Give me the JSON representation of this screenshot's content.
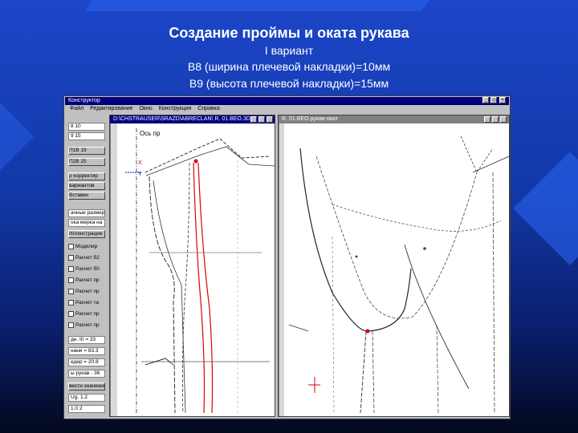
{
  "slide": {
    "title": "Создание проймы и оката рукава",
    "variant": "I вариант",
    "line_b8": "В8 (ширина плечевой накладки)=10мм",
    "line_b9": "В9  (высота плечевой накладки)=15мм"
  },
  "app": {
    "title": "Конструктор",
    "menu": [
      "Файл",
      "Редактирование",
      "Окно",
      "Конструкция",
      "Справка"
    ],
    "window_buttons": [
      "_",
      "□",
      "×"
    ],
    "panel": {
      "fields": [
        {
          "label": "8",
          "value": "10"
        },
        {
          "label": "9",
          "value": "15"
        }
      ],
      "buttons": [
        "П1В 19",
        "П2В 25",
        "р корректир",
        "вариантов",
        "Вставки"
      ],
      "info_rows": [
        "ачные размеры",
        "ока мерка на",
        "Иллюстрация"
      ],
      "checks": [
        "Моделир",
        "Расчет б2",
        "Расчет б0",
        "Расчет пр",
        "Расчет пр",
        "Расчет та",
        "Расчет пр",
        "Расчет пр"
      ],
      "values": [
        "дн. III = 33",
        "нани = 83.3",
        "едер = 20.8",
        "ы рукав - 36",
        "вести значения"
      ],
      "bottom_fields": [
        {
          "label": "Ug.",
          "value": "1.2"
        },
        {
          "label": "1.0",
          "value": "2"
        }
      ]
    },
    "left_window": {
      "title": "D:\\CHSTRAUSER\\SRAZD\\ABRECLAN\\    R. 01.BEO.3D",
      "axis_label": "Ось пр",
      "axis_x": "X",
      "axis_y": "Y"
    },
    "right_window": {
      "title": "R. 01.BEO.рукав-окат"
    }
  }
}
